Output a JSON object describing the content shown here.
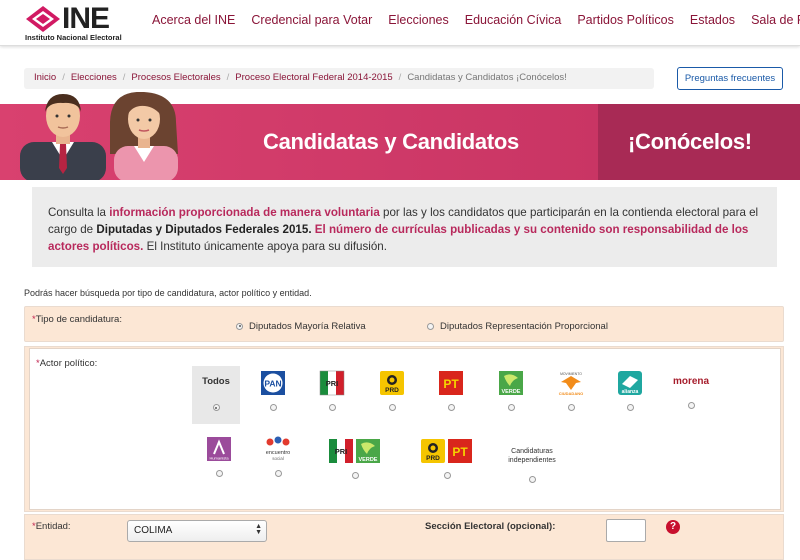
{
  "brand": {
    "name": "INE",
    "subtitle": "Instituto Nacional Electoral"
  },
  "nav": [
    "Acerca del INE",
    "Credencial para Votar",
    "Elecciones",
    "Educación Cívica",
    "Partidos Políticos",
    "Estados",
    "Sala de Prensa"
  ],
  "breadcrumb": [
    "Inicio",
    "Elecciones",
    "Procesos Electorales",
    "Proceso Electoral Federal 2014-2015",
    "Candidatas y Candidatos ¡Conócelos!"
  ],
  "faq_button": "Preguntas frecuentes",
  "banner": {
    "title": "Candidatas y Candidatos",
    "cta": "¡Conócelos!"
  },
  "info": {
    "p1": "Consulta la ",
    "p2": "información proporcionada de manera voluntaria",
    "p3": " por las y los candidatos que participarán en la contienda electoral para el cargo de ",
    "p4": "Diputadas y Diputados Federales 2015.",
    "p5": " ",
    "p6": "El número de currículas publicadas y su contenido son responsabilidad de los actores políticos.",
    "p7": " El Instituto únicamente apoya para su difusión."
  },
  "search_hint": "Podrás hacer búsqueda por tipo de candidatura, actor político y entidad.",
  "tipo": {
    "required_mark": "*",
    "label": "Tipo de candidatura:",
    "options": [
      "Diputados Mayoría Relativa",
      "Diputados Representación Proporcional"
    ],
    "selected": 0
  },
  "actor": {
    "required_mark": "*",
    "label": "Actor político:",
    "todos": "Todos",
    "selected": "Todos",
    "logos": {
      "pan": "PAN",
      "pri": "PRI",
      "prd": "PRD",
      "pt": "PT",
      "verde": "VERDE",
      "movimiento_top": "MOVIMIENTO",
      "movimiento_bottom": "CIUDADANO",
      "alianza": "alianza",
      "morena": "morena",
      "humanista": "Humanista",
      "encuentro_1": "encuentro",
      "encuentro_2": "social",
      "independientes_1": "Candidaturas",
      "independientes_2": "independientes"
    }
  },
  "entidad": {
    "required_mark": "*",
    "label": "Entidad:",
    "selected": "COLIMA",
    "seccion_label": "Sección Electoral (opcional):",
    "seccion_value": "",
    "help": "?"
  },
  "colors": {
    "accent": "#8a1538",
    "banner": "#d83d6f",
    "banner_dark": "#a82a55",
    "form_bg": "#fce7d5"
  }
}
